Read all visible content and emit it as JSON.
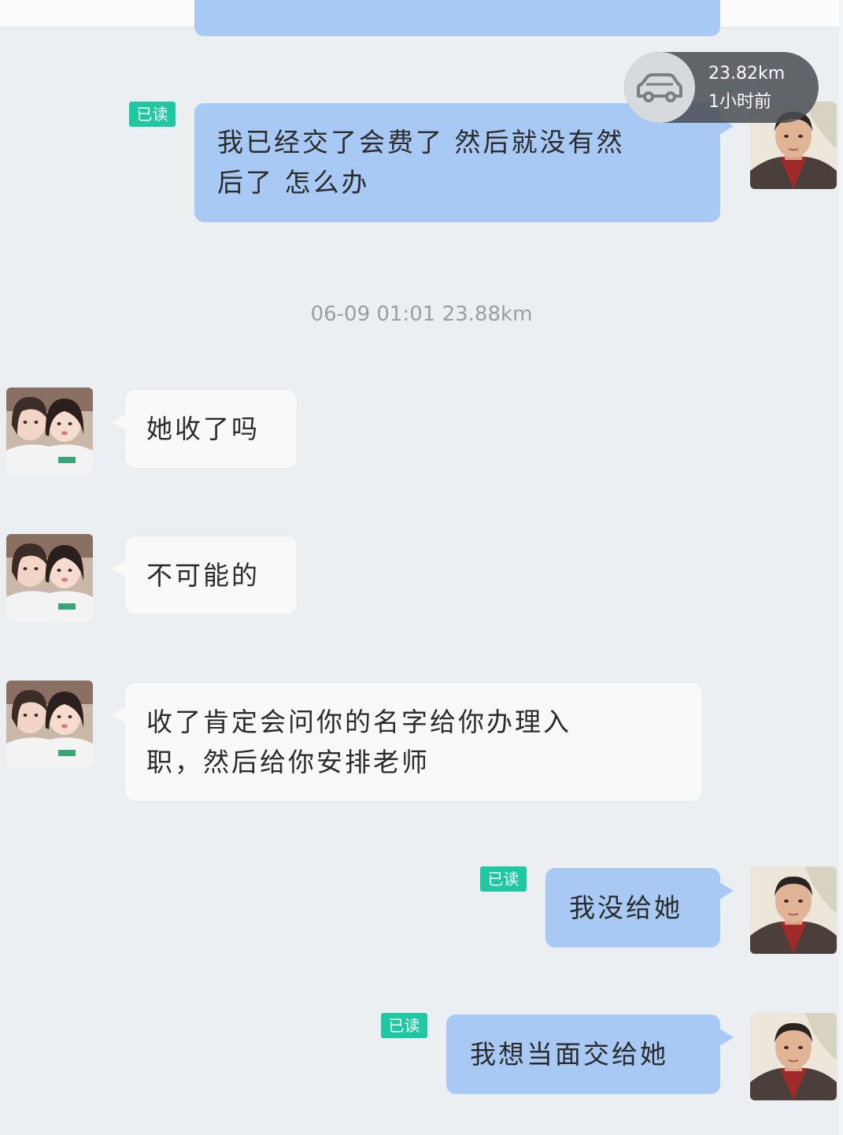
{
  "location_widget": {
    "distance": "23.82km",
    "time_ago": "1小时前",
    "icon": "car-icon"
  },
  "timestamp": "06-09 01:01  23.88km",
  "messages": [
    {
      "direction": "out",
      "read_badge": "已读",
      "lines": [
        "我已经交了会费了  然后就没有然",
        "后了  怎么办"
      ]
    },
    {
      "direction": "in",
      "lines": [
        "她收了吗"
      ]
    },
    {
      "direction": "in",
      "lines": [
        "不可能的"
      ]
    },
    {
      "direction": "in",
      "lines": [
        "收了肯定会问你的名字给你办理入",
        "职，然后给你安排老师"
      ]
    },
    {
      "direction": "out",
      "read_badge": "已读",
      "lines": [
        "我没给她"
      ]
    },
    {
      "direction": "out",
      "read_badge": "已读",
      "lines": [
        "我想当面交给她"
      ]
    }
  ],
  "colors": {
    "background": "#eceff1",
    "outgoing_bubble": "#a7c9f4",
    "incoming_bubble": "#f9f9f9",
    "read_badge": "#1fc7a2",
    "timestamp_text": "#9a9ea2"
  }
}
